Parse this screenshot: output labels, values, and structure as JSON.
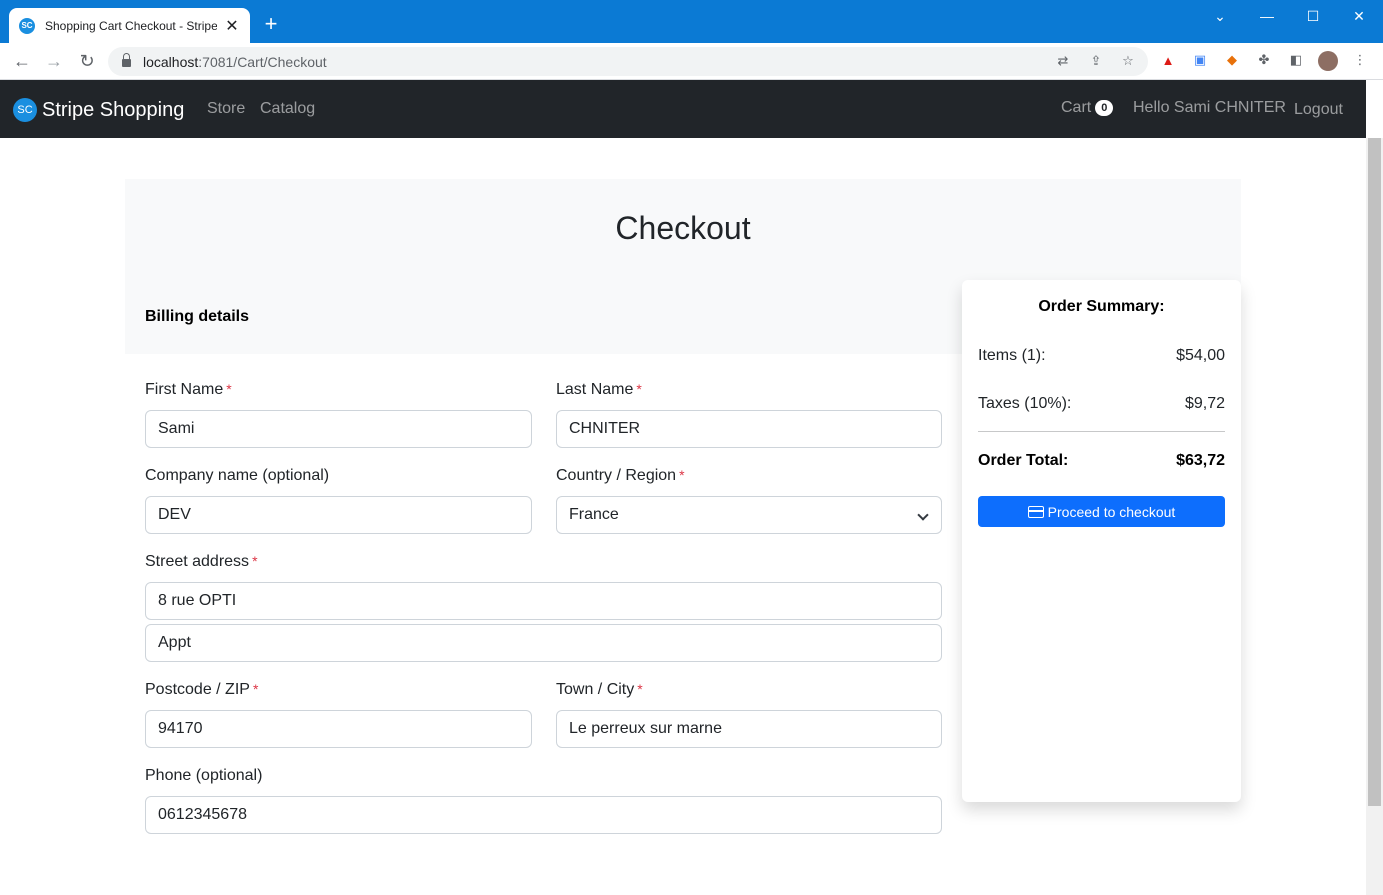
{
  "browser": {
    "tab_title": "Shopping Cart Checkout - Stripe",
    "tab_favicon": "SC",
    "url_host": "localhost",
    "url_path": ":7081/Cart/Checkout"
  },
  "navbar": {
    "brand_logo": "SC",
    "brand": "Stripe Shopping",
    "links": [
      "Store",
      "Catalog"
    ],
    "cart_label": "Cart",
    "cart_count": "0",
    "greeting": "Hello Sami CHNITER",
    "logout": "Logout"
  },
  "page": {
    "title": "Checkout",
    "billing_title": "Billing details"
  },
  "form": {
    "first_name": {
      "label": "First Name",
      "value": "Sami"
    },
    "last_name": {
      "label": "Last Name",
      "value": "CHNITER"
    },
    "company": {
      "label": "Company name (optional)",
      "value": "DEV"
    },
    "country": {
      "label": "Country / Region",
      "value": "France"
    },
    "street": {
      "label": "Street address",
      "value": "8 rue OPTI",
      "value2": "Appt"
    },
    "postcode": {
      "label": "Postcode / ZIP",
      "value": "94170"
    },
    "city": {
      "label": "Town / City",
      "value": "Le perreux sur marne"
    },
    "phone": {
      "label": "Phone (optional)",
      "value": "0612345678"
    },
    "required_mark": "*"
  },
  "summary": {
    "title": "Order Summary:",
    "items_label": "Items (1):",
    "items_value": "$54,00",
    "taxes_label": "Taxes (10%):",
    "taxes_value": "$9,72",
    "total_label": "Order Total:",
    "total_value": "$63,72",
    "button": "Proceed to checkout"
  },
  "colors": {
    "accent": "#0d6efd",
    "navbar": "#212529",
    "browser_frame": "#0b7ad4",
    "required": "#dc3545"
  }
}
